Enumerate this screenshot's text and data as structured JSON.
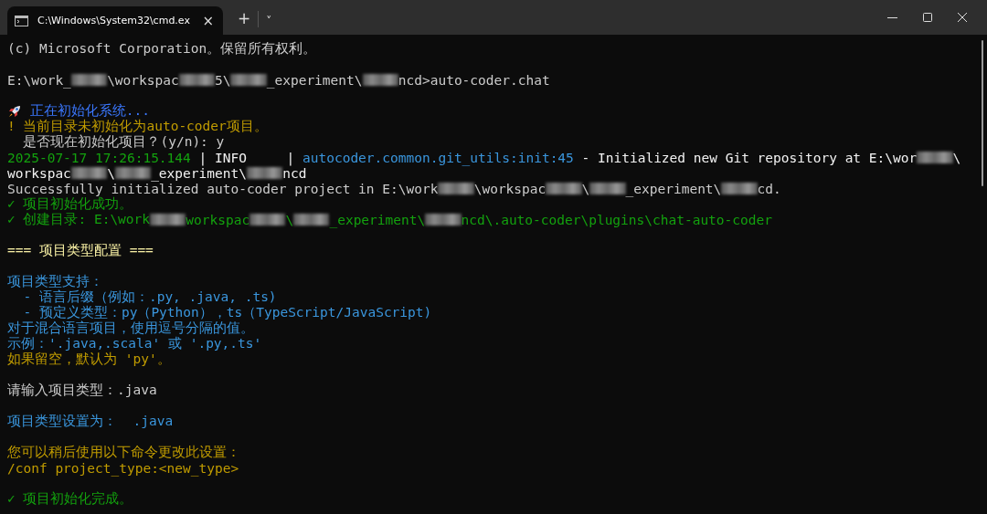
{
  "window": {
    "tab_title": "C:\\Windows\\System32\\cmd.ex",
    "tab_close": "×",
    "new_tab": "+",
    "tab_menu": "˅"
  },
  "lines": [
    {
      "kind": "text",
      "segments": [
        {
          "kind": "text",
          "text": "(c) Microsoft Corporation。保留所有权利。",
          "color": "#cccccc"
        }
      ]
    },
    {
      "kind": "blank"
    },
    {
      "kind": "text",
      "segments": [
        {
          "kind": "text",
          "text": "E:\\work_",
          "color": "#cccccc"
        },
        {
          "kind": "redacted"
        },
        {
          "kind": "text",
          "text": "\\workspac",
          "color": "#cccccc"
        },
        {
          "kind": "redacted"
        },
        {
          "kind": "text",
          "text": "5\\",
          "color": "#cccccc"
        },
        {
          "kind": "redacted"
        },
        {
          "kind": "text",
          "text": "_experiment\\",
          "color": "#cccccc"
        },
        {
          "kind": "redacted"
        },
        {
          "kind": "text",
          "text": "ncd>auto-coder.chat",
          "color": "#cccccc"
        }
      ]
    },
    {
      "kind": "blank"
    },
    {
      "kind": "text",
      "segments": [
        {
          "kind": "icon"
        },
        {
          "kind": "text",
          "text": " 正在初始化系统...",
          "color": "#3b78ff"
        }
      ]
    },
    {
      "kind": "text",
      "segments": [
        {
          "kind": "text",
          "text": "! 当前目录未初始化为auto-coder项目。",
          "color": "#c19c00"
        }
      ]
    },
    {
      "kind": "text",
      "segments": [
        {
          "kind": "text",
          "text": "  是否现在初始化项目？(y/n): y",
          "color": "#cccccc"
        }
      ]
    },
    {
      "kind": "text",
      "segments": [
        {
          "kind": "text",
          "text": "2025-07-17 17:26:15.144",
          "color": "#13a10e"
        },
        {
          "kind": "text",
          "text": " | INFO     | ",
          "color": "#f2f2f2"
        },
        {
          "kind": "text",
          "text": "autocoder.common.git_utils:init:45",
          "color": "#3a96dd"
        },
        {
          "kind": "text",
          "text": " - Initialized new Git repository at E:\\wor",
          "color": "#f2f2f2"
        },
        {
          "kind": "redacted"
        },
        {
          "kind": "text",
          "text": "\\",
          "color": "#f2f2f2"
        }
      ]
    },
    {
      "kind": "text",
      "segments": [
        {
          "kind": "text",
          "text": "workspac",
          "color": "#f2f2f2"
        },
        {
          "kind": "redacted"
        },
        {
          "kind": "text",
          "text": "\\",
          "color": "#f2f2f2"
        },
        {
          "kind": "redacted"
        },
        {
          "kind": "text",
          "text": "_experiment\\",
          "color": "#f2f2f2"
        },
        {
          "kind": "redacted"
        },
        {
          "kind": "text",
          "text": "ncd",
          "color": "#f2f2f2"
        }
      ]
    },
    {
      "kind": "text",
      "segments": [
        {
          "kind": "text",
          "text": "Successfully initialized auto-coder project in E:\\work",
          "color": "#cccccc"
        },
        {
          "kind": "redacted"
        },
        {
          "kind": "text",
          "text": "\\workspac",
          "color": "#cccccc"
        },
        {
          "kind": "redacted"
        },
        {
          "kind": "text",
          "text": "\\",
          "color": "#cccccc"
        },
        {
          "kind": "redacted"
        },
        {
          "kind": "text",
          "text": "_experiment\\",
          "color": "#cccccc"
        },
        {
          "kind": "redacted"
        },
        {
          "kind": "text",
          "text": "cd.",
          "color": "#cccccc"
        }
      ]
    },
    {
      "kind": "text",
      "segments": [
        {
          "kind": "text",
          "text": "✓ 项目初始化成功。",
          "color": "#13a10e"
        }
      ]
    },
    {
      "kind": "text",
      "segments": [
        {
          "kind": "text",
          "text": "✓ 创建目录: E:\\work",
          "color": "#13a10e"
        },
        {
          "kind": "redacted"
        },
        {
          "kind": "text",
          "text": "workspac",
          "color": "#13a10e"
        },
        {
          "kind": "redacted"
        },
        {
          "kind": "text",
          "text": "\\",
          "color": "#13a10e"
        },
        {
          "kind": "redacted"
        },
        {
          "kind": "text",
          "text": "_experiment\\",
          "color": "#13a10e"
        },
        {
          "kind": "redacted"
        },
        {
          "kind": "text",
          "text": "ncd\\.auto-coder\\plugins\\chat-auto-coder",
          "color": "#13a10e"
        }
      ]
    },
    {
      "kind": "blank"
    },
    {
      "kind": "text",
      "segments": [
        {
          "kind": "text",
          "text": "=== 项目类型配置 ===",
          "color": "#f9f1a5"
        }
      ]
    },
    {
      "kind": "blank"
    },
    {
      "kind": "text",
      "segments": [
        {
          "kind": "text",
          "text": "项目类型支持：",
          "color": "#3a96dd"
        }
      ]
    },
    {
      "kind": "text",
      "segments": [
        {
          "kind": "text",
          "text": "  - 语言后缀（例如：.py, .java, .ts)",
          "color": "#3a96dd"
        }
      ]
    },
    {
      "kind": "text",
      "segments": [
        {
          "kind": "text",
          "text": "  - 预定义类型：py（Python），ts（TypeScript/JavaScript)",
          "color": "#3a96dd"
        }
      ]
    },
    {
      "kind": "text",
      "segments": [
        {
          "kind": "text",
          "text": "对于混合语言项目，使用逗号分隔的值。",
          "color": "#3a96dd"
        }
      ]
    },
    {
      "kind": "text",
      "segments": [
        {
          "kind": "text",
          "text": "示例：'.java,.scala' 或 '.py,.ts'",
          "color": "#3a96dd"
        }
      ]
    },
    {
      "kind": "text",
      "segments": [
        {
          "kind": "text",
          "text": "如果留空，默认为 'py'。",
          "color": "#c19c00"
        }
      ]
    },
    {
      "kind": "blank"
    },
    {
      "kind": "text",
      "segments": [
        {
          "kind": "text",
          "text": "请输入项目类型：.java",
          "color": "#cccccc"
        }
      ]
    },
    {
      "kind": "blank"
    },
    {
      "kind": "text",
      "segments": [
        {
          "kind": "text",
          "text": "项目类型设置为：  .java",
          "color": "#3a96dd"
        }
      ]
    },
    {
      "kind": "blank"
    },
    {
      "kind": "text",
      "segments": [
        {
          "kind": "text",
          "text": "您可以稍后使用以下命令更改此设置：",
          "color": "#c19c00"
        }
      ]
    },
    {
      "kind": "text",
      "segments": [
        {
          "kind": "text",
          "text": "/conf project_type:<new_type>",
          "color": "#c19c00"
        }
      ]
    },
    {
      "kind": "blank"
    },
    {
      "kind": "text",
      "segments": [
        {
          "kind": "text",
          "text": "✓ 项目初始化完成。",
          "color": "#13a10e"
        }
      ]
    }
  ]
}
